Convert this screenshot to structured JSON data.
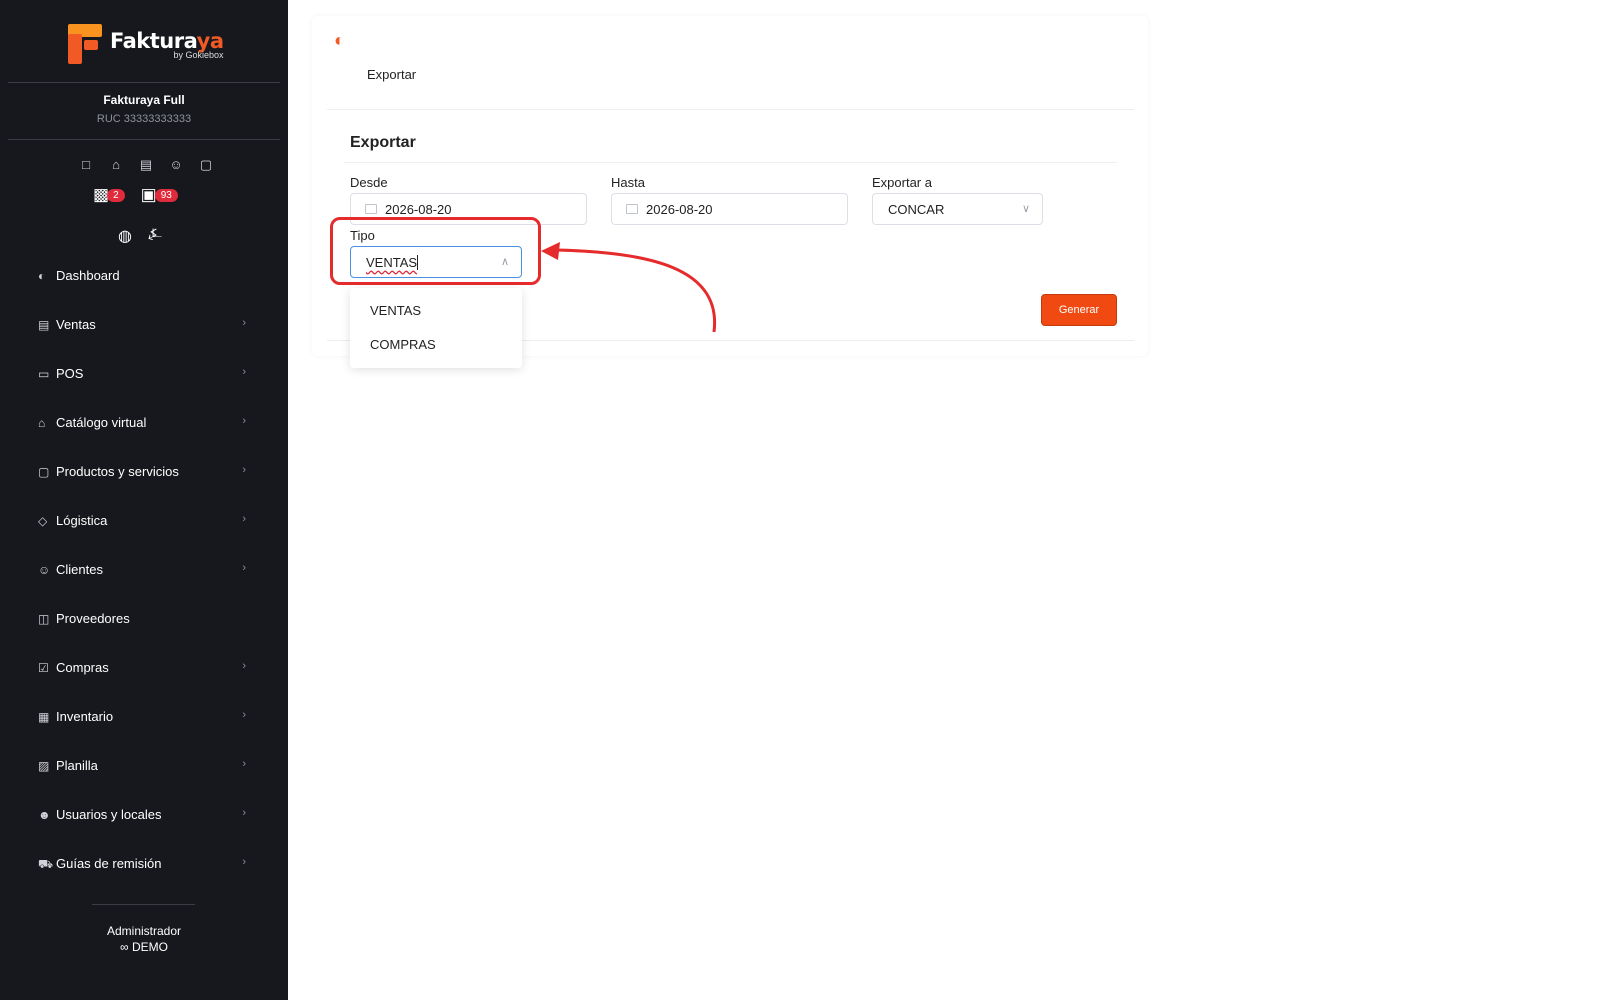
{
  "brand": {
    "name_main": "Faktura",
    "name_accent": "ya",
    "byline": "by Gokiebox"
  },
  "company": {
    "name": "Fakturaya Full",
    "ruc": "RUC 33333333333"
  },
  "quick_icons": [
    "file-icon",
    "store-icon",
    "receipt-icon",
    "users-icon",
    "box-icon"
  ],
  "badges": [
    {
      "icon": "calendar-x-icon",
      "count": "2"
    },
    {
      "icon": "boxes-icon",
      "count": "93"
    }
  ],
  "menu": [
    {
      "label": "Dashboard",
      "icon": "gauge-icon",
      "has_children": false
    },
    {
      "label": "Ventas",
      "icon": "receipt-icon",
      "has_children": true
    },
    {
      "label": "POS",
      "icon": "monitor-icon",
      "has_children": true
    },
    {
      "label": "Catálogo virtual",
      "icon": "store-icon",
      "has_children": true
    },
    {
      "label": "Productos y servicios",
      "icon": "box-icon",
      "has_children": true
    },
    {
      "label": "Lógistica",
      "icon": "tag-icon",
      "has_children": true
    },
    {
      "label": "Clientes",
      "icon": "users-icon",
      "has_children": true
    },
    {
      "label": "Proveedores",
      "icon": "briefcase-icon",
      "has_children": false
    },
    {
      "label": "Compras",
      "icon": "bag-icon",
      "has_children": true
    },
    {
      "label": "Inventario",
      "icon": "book-icon",
      "has_children": true
    },
    {
      "label": "Planilla",
      "icon": "id-icon",
      "has_children": true
    },
    {
      "label": "Usuarios y locales",
      "icon": "user-group-icon",
      "has_children": true
    },
    {
      "label": "Guías de remisión",
      "icon": "truck-icon",
      "has_children": true
    }
  ],
  "footer": {
    "role": "Administrador",
    "mode": "DEMO"
  },
  "page": {
    "breadcrumb": "Exportar",
    "card_title": "Exportar"
  },
  "form": {
    "desde_label": "Desde",
    "desde_value": "2026-08-20",
    "hasta_label": "Hasta",
    "hasta_value": "2026-08-20",
    "exportar_label": "Exportar a",
    "exportar_value": "CONCAR",
    "tipo_label": "Tipo",
    "tipo_value": "VENTAS",
    "tipo_options": [
      "VENTAS",
      "COMPRAS"
    ],
    "submit_label": "Generar"
  },
  "colors": {
    "accent": "#f15a24",
    "sidebar_bg": "#16181d",
    "badge": "#e02b3c",
    "highlight": "#e52b2b"
  }
}
